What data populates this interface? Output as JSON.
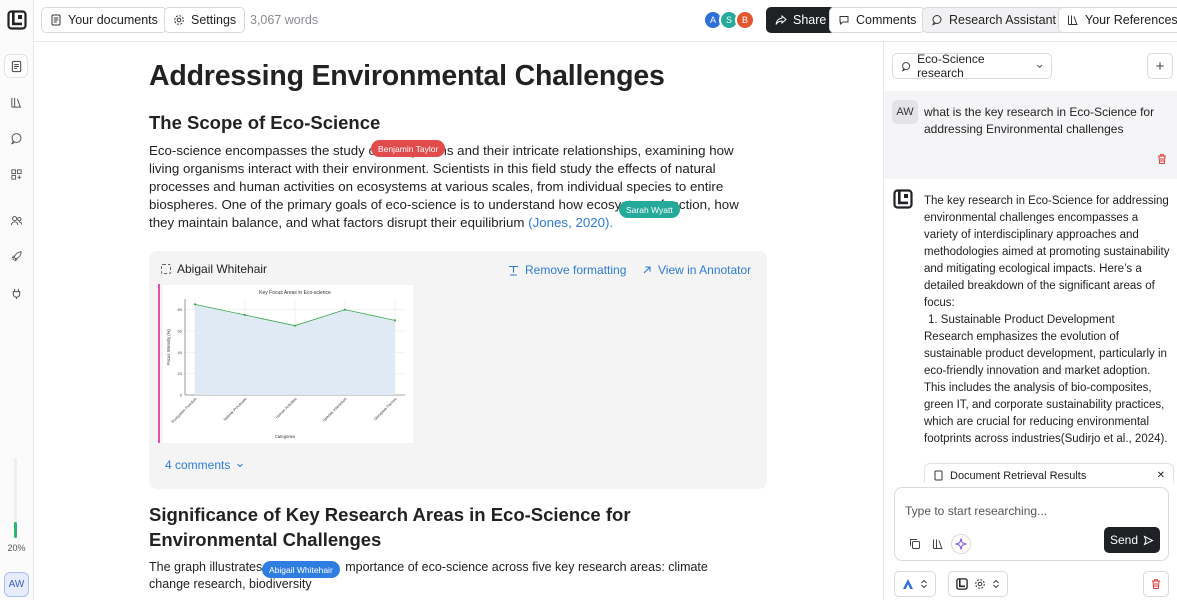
{
  "app": {
    "logo_icon": "app-logo-icon"
  },
  "rail": {
    "items": [
      {
        "name": "documents",
        "icon": "document-icon"
      },
      {
        "name": "library",
        "icon": "library-icon"
      },
      {
        "name": "chat",
        "icon": "chat-icon"
      },
      {
        "name": "grid",
        "icon": "grid-icon"
      },
      {
        "name": "users",
        "icon": "users-icon"
      },
      {
        "name": "rocket",
        "icon": "rocket-icon"
      },
      {
        "name": "plugin",
        "icon": "plug-icon"
      }
    ],
    "progress_label": "20%",
    "progress_value": 0.2,
    "user_initials": "AW"
  },
  "toolbar": {
    "your_documents": "Your documents",
    "settings": "Settings",
    "word_count": "3,067 words",
    "collaborators": [
      {
        "initial": "A",
        "color": "#2f6fd8"
      },
      {
        "initial": "S",
        "color": "#24a99a"
      },
      {
        "initial": "B",
        "color": "#e4572e"
      }
    ],
    "share": "Share",
    "comments": "Comments",
    "research_assistant": "Research Assistant",
    "your_references": "Your References"
  },
  "document": {
    "title": "Addressing Environmental Challenges",
    "section1_heading": "The Scope of Eco-Science",
    "para1_a": "Eco-science encompasses the study of ecosystems and their intricate relationships, examining how living organisms interact with their environment. Scientists in this field study the effects of natural processes and human activities on ecosystems at various scales, from individual species to entire biospheres. One of the primary goals of eco-science is to understand how ecosystems function, how they maintain balance, and what factors disrupt their equilibrium ",
    "para1_citation": "(Jones, 2020).",
    "cursors": [
      {
        "name": "Benjamin Taylor",
        "color": "#e24b4b"
      },
      {
        "name": "Sarah Wyatt",
        "color": "#25a99a"
      },
      {
        "name": "Abigail Whitehair",
        "color": "#2f7de0"
      }
    ],
    "embed": {
      "author": "Abigail Whitehair",
      "remove_formatting": "Remove formatting",
      "view_in_annotator": "View in Annotator",
      "comments_link": "4 comments"
    },
    "section2_heading": "Significance of Key Research Areas in Eco-Science for Environmental Challenges",
    "para2_a": "The graph illustrates t",
    "para2_b": "mportance of eco-science across five key research areas: climate change research, biodiversity"
  },
  "chart_data": {
    "type": "area",
    "title": "Key Focus Areas in Eco-science",
    "xlabel": "Categories",
    "ylabel": "Focus Intensity (%)",
    "categories": [
      "Ecosystem Function",
      "Natural Processes",
      "Human Activities",
      "Species Interaction",
      "Disruptive Factors"
    ],
    "values": [
      85,
      75,
      65,
      80,
      70
    ],
    "ylim": [
      0,
      90
    ],
    "yticks": [
      0,
      20,
      40,
      60,
      80
    ],
    "grid": true,
    "color": "#3aa84a",
    "fill": "#dbe8f4"
  },
  "panel": {
    "session": "Eco-Science research",
    "question_initials": "AW",
    "question": "what is the key research in Eco-Science for addressing Environmental challenges",
    "answer_intro": "The key research in Eco-Science for addressing environmental challenges encompasses a variety of interdisciplinary approaches and methodologies aimed at promoting sustainability and mitigating ecological impacts. Here’s a detailed breakdown of the significant areas of focus:",
    "answer_list_item": "1.  Sustainable Product Development",
    "answer_body": "Research emphasizes the evolution of sustainable product development, particularly in eco-friendly innovation and market adoption. This includes the analysis of bio-composites, green IT, and corporate sustainability practices, which are crucial for reducing environmental footprints across industries(Sudirjo et al., 2024).",
    "retrieval_label": "Document Retrieval Results",
    "input_placeholder": "Type to start researching...",
    "send": "Send"
  }
}
